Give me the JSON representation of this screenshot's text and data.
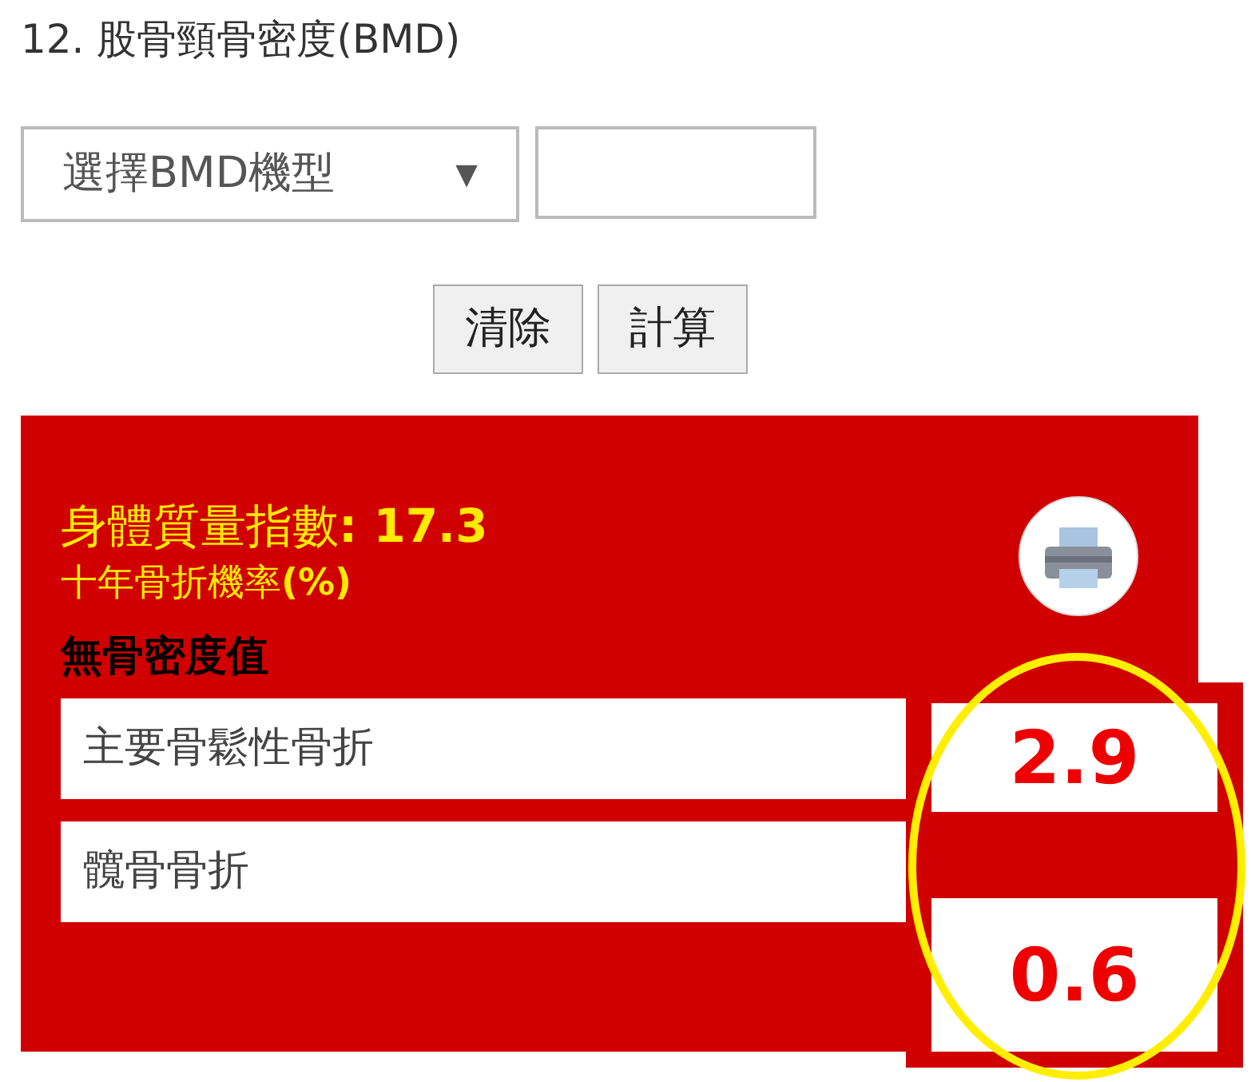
{
  "section": {
    "title": "12. 股骨頸骨密度(BMD)"
  },
  "form": {
    "select": {
      "value": "選擇BMD機型",
      "caret": "▼"
    },
    "buttons": [
      "清除",
      "計算"
    ]
  },
  "result": {
    "bmi": "身體質量指數**: 17.3**",
    "probability_label": "十年骨折機率**(%)**",
    "group_title": "無骨密度值",
    "rows": [
      {
        "label": "主要骨鬆性骨折",
        "value": "2.9"
      },
      {
        "label": "髖骨骨折",
        "value": "0.6"
      }
    ]
  }
}
